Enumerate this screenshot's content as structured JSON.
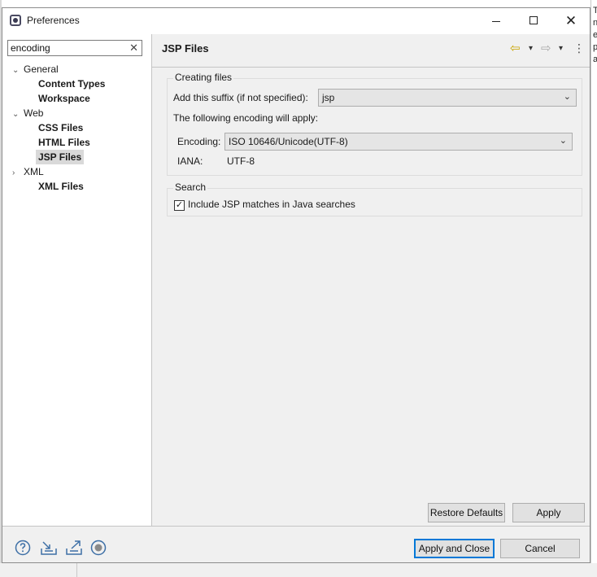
{
  "window": {
    "title": "Preferences",
    "close_glyph": "✕"
  },
  "background": {
    "right_text_lines": [
      "T",
      "n",
      "e",
      "p",
      "a"
    ]
  },
  "filter": {
    "value": "encoding",
    "clear_glyph": "✕"
  },
  "tree": {
    "groups": [
      {
        "label": "General",
        "twisty": "⌄",
        "children": [
          "Content Types",
          "Workspace"
        ]
      },
      {
        "label": "Web",
        "twisty": "⌄",
        "children": [
          "CSS Files",
          "HTML Files",
          "JSP Files"
        ]
      },
      {
        "label": "XML",
        "twisty": "›",
        "children": [
          "XML Files"
        ]
      }
    ],
    "selected": "JSP Files"
  },
  "page": {
    "title": "JSP Files",
    "nav_back_glyph": "⇦",
    "nav_forward_glyph": "⇨",
    "nav_menu_glyph": "⋮",
    "dropdown_glyph": "▾"
  },
  "creating_files": {
    "group_title": "Creating files",
    "suffix_label": "Add this suffix (if not specified):",
    "suffix_value": "jsp",
    "encoding_note": "The following encoding will apply:",
    "encoding_label": "Encoding:",
    "encoding_value": "ISO 10646/Unicode(UTF-8)",
    "iana_label": "IANA:",
    "iana_value": "UTF-8",
    "chevron_glyph": "⌄"
  },
  "search": {
    "group_title": "Search",
    "checkbox_label": "Include JSP matches in Java searches",
    "checked": true,
    "check_glyph": "✓"
  },
  "buttons": {
    "restore_defaults": "Restore Defaults",
    "apply": "Apply",
    "apply_and_close": "Apply and Close",
    "cancel": "Cancel"
  },
  "footer_icons": [
    "help-icon",
    "import-icon",
    "export-icon",
    "record-icon"
  ]
}
